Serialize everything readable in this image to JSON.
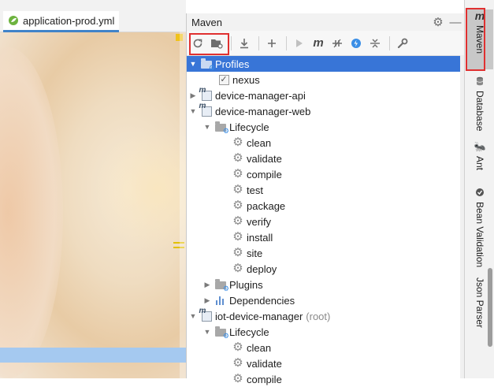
{
  "editor": {
    "tab_label": "application-prod.yml"
  },
  "maven": {
    "title": "Maven",
    "toolbar": {
      "buttons": [
        "reload-icon",
        "folder-sync-icon",
        "download-icon",
        "add-icon",
        "run-icon",
        "maven-goal-icon",
        "toggle-offline-icon",
        "skip-tests-icon",
        "collapse-all-icon",
        "settings-wrench-icon"
      ]
    },
    "tree": [
      {
        "label": "Profiles",
        "expanded": true,
        "selected": true
      },
      {
        "label": "nexus",
        "checked": true
      },
      {
        "label": "device-manager-api",
        "expanded": false
      },
      {
        "label": "device-manager-web",
        "expanded": true
      },
      {
        "label": "Lifecycle",
        "expanded": true
      },
      {
        "label": "clean"
      },
      {
        "label": "validate"
      },
      {
        "label": "compile"
      },
      {
        "label": "test"
      },
      {
        "label": "package"
      },
      {
        "label": "verify"
      },
      {
        "label": "install"
      },
      {
        "label": "site"
      },
      {
        "label": "deploy"
      },
      {
        "label": "Plugins",
        "expanded": false
      },
      {
        "label": "Dependencies",
        "expanded": false
      },
      {
        "label": "iot-device-manager",
        "suffix": "(root)",
        "expanded": true
      },
      {
        "label": "Lifecycle",
        "expanded": true
      },
      {
        "label": "clean"
      },
      {
        "label": "validate"
      },
      {
        "label": "compile"
      }
    ]
  },
  "strip": {
    "tabs": [
      {
        "label": "Maven",
        "icon": "maven-icon",
        "active": true
      },
      {
        "label": "Database",
        "icon": "database-icon"
      },
      {
        "label": "Ant",
        "icon": "ant-icon"
      },
      {
        "label": "Bean Validation",
        "icon": "bean-validation-icon"
      },
      {
        "label": "Json Parser",
        "icon": "json-parser-icon"
      }
    ]
  },
  "colors": {
    "selection": "#3875d7",
    "highlight_box": "#e03030",
    "editor_tab_underline": "#4083c9"
  }
}
